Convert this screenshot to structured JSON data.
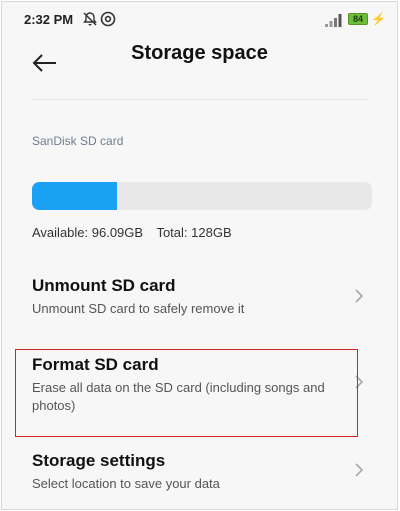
{
  "status_bar": {
    "time": "2:32 PM",
    "icons": [
      "notification-off-icon",
      "at-sign-icon",
      "cell-signal-icon",
      "battery-icon",
      "charging-icon"
    ],
    "battery_level": "84",
    "charging_symbol": "⚡"
  },
  "header": {
    "title": "Storage space",
    "back_icon": "back-arrow-icon"
  },
  "storage": {
    "label": "SanDisk SD card",
    "available": "Available: 96.09GB",
    "total": "Total: 128GB",
    "used_fraction": 0.249,
    "bar_color": "#1aa1f4",
    "track_color": "#e8e8e8"
  },
  "options": [
    {
      "title": "Unmount SD card",
      "subtitle": "Unmount SD card to safely remove it"
    },
    {
      "title": "Format SD card",
      "subtitle": "Erase all data on the SD card (including songs and photos)"
    },
    {
      "title": "Storage settings",
      "subtitle": "Select location to save your data"
    }
  ],
  "highlight_color": "#d22323"
}
